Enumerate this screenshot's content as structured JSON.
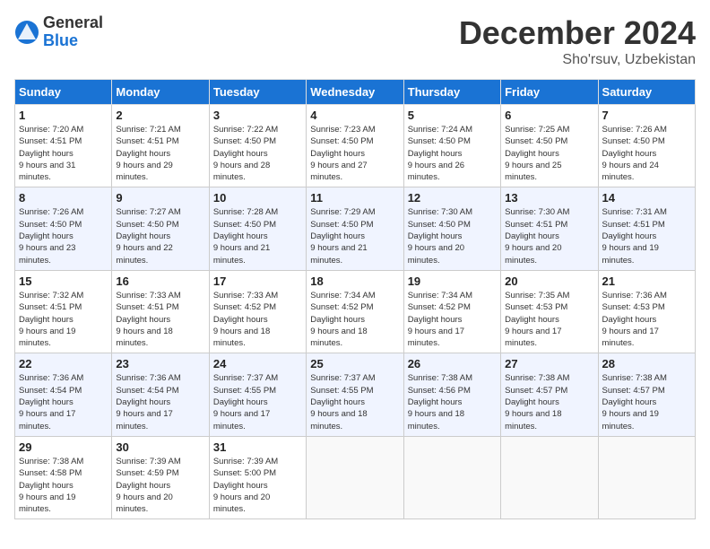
{
  "logo": {
    "general": "General",
    "blue": "Blue"
  },
  "title": "December 2024",
  "location": "Sho'rsuv, Uzbekistan",
  "days_header": [
    "Sunday",
    "Monday",
    "Tuesday",
    "Wednesday",
    "Thursday",
    "Friday",
    "Saturday"
  ],
  "weeks": [
    [
      {
        "day": "1",
        "sunrise": "7:20 AM",
        "sunset": "4:51 PM",
        "daylight": "9 hours and 31 minutes."
      },
      {
        "day": "2",
        "sunrise": "7:21 AM",
        "sunset": "4:51 PM",
        "daylight": "9 hours and 29 minutes."
      },
      {
        "day": "3",
        "sunrise": "7:22 AM",
        "sunset": "4:50 PM",
        "daylight": "9 hours and 28 minutes."
      },
      {
        "day": "4",
        "sunrise": "7:23 AM",
        "sunset": "4:50 PM",
        "daylight": "9 hours and 27 minutes."
      },
      {
        "day": "5",
        "sunrise": "7:24 AM",
        "sunset": "4:50 PM",
        "daylight": "9 hours and 26 minutes."
      },
      {
        "day": "6",
        "sunrise": "7:25 AM",
        "sunset": "4:50 PM",
        "daylight": "9 hours and 25 minutes."
      },
      {
        "day": "7",
        "sunrise": "7:26 AM",
        "sunset": "4:50 PM",
        "daylight": "9 hours and 24 minutes."
      }
    ],
    [
      {
        "day": "8",
        "sunrise": "7:26 AM",
        "sunset": "4:50 PM",
        "daylight": "9 hours and 23 minutes."
      },
      {
        "day": "9",
        "sunrise": "7:27 AM",
        "sunset": "4:50 PM",
        "daylight": "9 hours and 22 minutes."
      },
      {
        "day": "10",
        "sunrise": "7:28 AM",
        "sunset": "4:50 PM",
        "daylight": "9 hours and 21 minutes."
      },
      {
        "day": "11",
        "sunrise": "7:29 AM",
        "sunset": "4:50 PM",
        "daylight": "9 hours and 21 minutes."
      },
      {
        "day": "12",
        "sunrise": "7:30 AM",
        "sunset": "4:50 PM",
        "daylight": "9 hours and 20 minutes."
      },
      {
        "day": "13",
        "sunrise": "7:30 AM",
        "sunset": "4:51 PM",
        "daylight": "9 hours and 20 minutes."
      },
      {
        "day": "14",
        "sunrise": "7:31 AM",
        "sunset": "4:51 PM",
        "daylight": "9 hours and 19 minutes."
      }
    ],
    [
      {
        "day": "15",
        "sunrise": "7:32 AM",
        "sunset": "4:51 PM",
        "daylight": "9 hours and 19 minutes."
      },
      {
        "day": "16",
        "sunrise": "7:33 AM",
        "sunset": "4:51 PM",
        "daylight": "9 hours and 18 minutes."
      },
      {
        "day": "17",
        "sunrise": "7:33 AM",
        "sunset": "4:52 PM",
        "daylight": "9 hours and 18 minutes."
      },
      {
        "day": "18",
        "sunrise": "7:34 AM",
        "sunset": "4:52 PM",
        "daylight": "9 hours and 18 minutes."
      },
      {
        "day": "19",
        "sunrise": "7:34 AM",
        "sunset": "4:52 PM",
        "daylight": "9 hours and 17 minutes."
      },
      {
        "day": "20",
        "sunrise": "7:35 AM",
        "sunset": "4:53 PM",
        "daylight": "9 hours and 17 minutes."
      },
      {
        "day": "21",
        "sunrise": "7:36 AM",
        "sunset": "4:53 PM",
        "daylight": "9 hours and 17 minutes."
      }
    ],
    [
      {
        "day": "22",
        "sunrise": "7:36 AM",
        "sunset": "4:54 PM",
        "daylight": "9 hours and 17 minutes."
      },
      {
        "day": "23",
        "sunrise": "7:36 AM",
        "sunset": "4:54 PM",
        "daylight": "9 hours and 17 minutes."
      },
      {
        "day": "24",
        "sunrise": "7:37 AM",
        "sunset": "4:55 PM",
        "daylight": "9 hours and 17 minutes."
      },
      {
        "day": "25",
        "sunrise": "7:37 AM",
        "sunset": "4:55 PM",
        "daylight": "9 hours and 18 minutes."
      },
      {
        "day": "26",
        "sunrise": "7:38 AM",
        "sunset": "4:56 PM",
        "daylight": "9 hours and 18 minutes."
      },
      {
        "day": "27",
        "sunrise": "7:38 AM",
        "sunset": "4:57 PM",
        "daylight": "9 hours and 18 minutes."
      },
      {
        "day": "28",
        "sunrise": "7:38 AM",
        "sunset": "4:57 PM",
        "daylight": "9 hours and 19 minutes."
      }
    ],
    [
      {
        "day": "29",
        "sunrise": "7:38 AM",
        "sunset": "4:58 PM",
        "daylight": "9 hours and 19 minutes."
      },
      {
        "day": "30",
        "sunrise": "7:39 AM",
        "sunset": "4:59 PM",
        "daylight": "9 hours and 20 minutes."
      },
      {
        "day": "31",
        "sunrise": "7:39 AM",
        "sunset": "5:00 PM",
        "daylight": "9 hours and 20 minutes."
      },
      null,
      null,
      null,
      null
    ]
  ],
  "labels": {
    "sunrise": "Sunrise:",
    "sunset": "Sunset:",
    "daylight": "Daylight hours"
  }
}
